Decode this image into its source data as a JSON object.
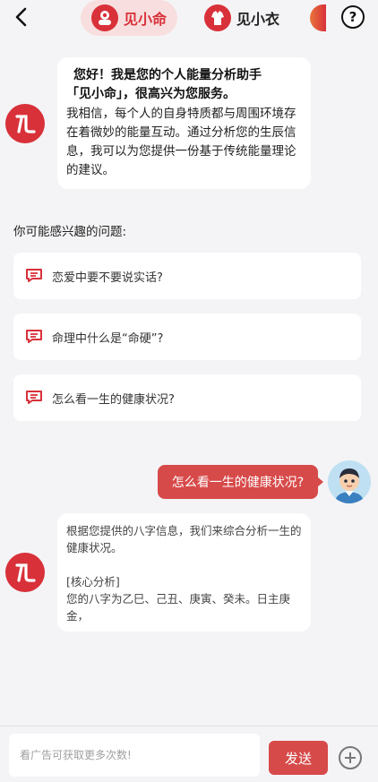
{
  "header": {
    "tabs": [
      {
        "label": "见小命",
        "active": true
      },
      {
        "label": "见小衣",
        "active": false
      }
    ],
    "help_label": "?"
  },
  "chat": {
    "welcome": {
      "heading_line1": "您好！我是您的个人能量分析助手",
      "heading_line2": "「见小命」，很高兴为您服务。",
      "body": "我相信，每个人的自身特质都与周围环境存在着微妙的能量互动。通过分析您的生辰信息，我可以为您提供一份基于传统能量理论的建议。"
    },
    "suggestions_title": "你可能感兴趣的问题:",
    "suggestions": [
      {
        "text": "恋爱中要不要说实话?"
      },
      {
        "text": "命理中什么是“命硬”?"
      },
      {
        "text": "怎么看一生的健康状况?"
      }
    ],
    "user_message": "怎么看一生的健康状况?",
    "answer": {
      "intro": "根据您提供的八字信息，我们来综合分析一生的健康状况。",
      "section": "[核心分析]",
      "detail": "您的八字为乙巳、己丑、庚寅、癸未。日主庚金，"
    }
  },
  "input": {
    "placeholder": "看广告可获取更多次数!",
    "send_label": "发送"
  },
  "colors": {
    "accent": "#d74a4a",
    "brand_red": "#d8313a",
    "active_tab_bg": "#f8dede",
    "background": "#f4f4f6"
  },
  "icons": {
    "back": "chevron-left-icon",
    "help": "question-circle-icon",
    "suggestion": "chat-bubble-icon",
    "add": "plus-circle-icon"
  }
}
